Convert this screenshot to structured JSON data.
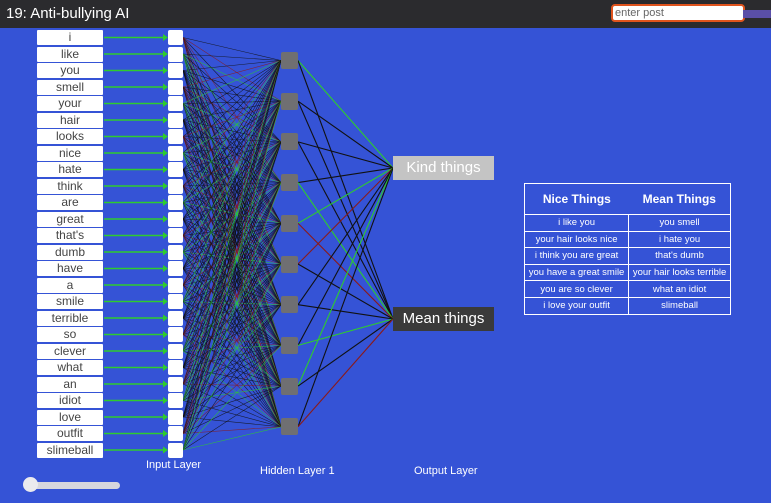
{
  "app": {
    "title": "19: Anti-bullying AI"
  },
  "post_input": {
    "placeholder": "enter post"
  },
  "input_words": [
    "i",
    "like",
    "you",
    "smell",
    "your",
    "hair",
    "looks",
    "nice",
    "hate",
    "think",
    "are",
    "great",
    "that's",
    "dumb",
    "have",
    "a",
    "smile",
    "terrible",
    "so",
    "clever",
    "what",
    "an",
    "idiot",
    "love",
    "outfit",
    "slimeball"
  ],
  "outputs": {
    "kind": "Kind things",
    "mean": "Mean things"
  },
  "layers": {
    "input": "Input Layer",
    "hidden": "Hidden Layer 1",
    "output": "Output Layer"
  },
  "examples": {
    "headers": [
      "Nice Things",
      "Mean Things"
    ],
    "rows": [
      [
        "i like you",
        "you smell"
      ],
      [
        "your hair looks nice",
        "i hate you"
      ],
      [
        "i think you are great",
        "that's dumb"
      ],
      [
        "you have a great smile",
        "your hair looks terrible"
      ],
      [
        "you are so clever",
        "what an idiot"
      ],
      [
        "i love your outfit",
        "slimeball"
      ]
    ]
  },
  "colors": {
    "background": "#3553d6",
    "positive_edge": "#2ecc2e",
    "negative_edge": "#8b1a1a",
    "neutral_edge": "#111111"
  },
  "slider": {
    "value": 0.0
  }
}
